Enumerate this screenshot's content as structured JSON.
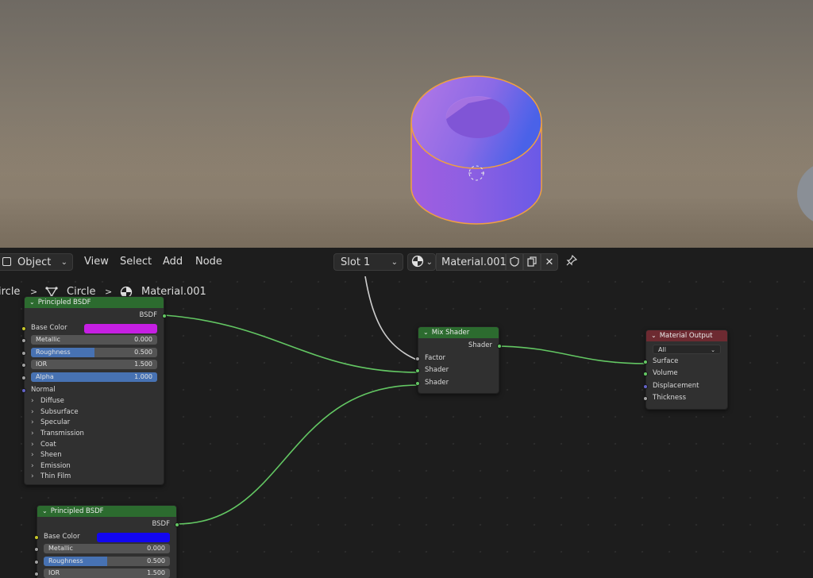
{
  "header": {
    "mode": "Object",
    "menus": [
      "View",
      "Select",
      "Add",
      "Node"
    ],
    "slot": "Slot 1",
    "material_name": "Material.001"
  },
  "breadcrumb": {
    "object": "ircle",
    "mesh": "Circle",
    "material": "Material.001"
  },
  "nodes": {
    "bsdf1": {
      "title": "Principled BSDF",
      "output": "BSDF",
      "base_color_label": "Base Color",
      "base_color": "#c61fe3",
      "metallic_label": "Metallic",
      "metallic": "0.000",
      "roughness_label": "Roughness",
      "roughness": "0.500",
      "ior_label": "IOR",
      "ior": "1.500",
      "alpha_label": "Alpha",
      "alpha": "1.000",
      "normal_label": "Normal",
      "panels": [
        "Diffuse",
        "Subsurface",
        "Specular",
        "Transmission",
        "Coat",
        "Sheen",
        "Emission",
        "Thin Film"
      ]
    },
    "bsdf2": {
      "title": "Principled BSDF",
      "output": "BSDF",
      "base_color_label": "Base Color",
      "base_color": "#1206f0",
      "metallic_label": "Metallic",
      "metallic": "0.000",
      "roughness_label": "Roughness",
      "roughness": "0.500",
      "ior_label": "IOR",
      "ior": "1.500"
    },
    "mix": {
      "title": "Mix Shader",
      "output": "Shader",
      "factor": "Factor",
      "shader_a": "Shader",
      "shader_b": "Shader"
    },
    "output": {
      "title": "Material Output",
      "target": "All",
      "surface": "Surface",
      "volume": "Volume",
      "displacement": "Displacement",
      "thickness": "Thickness"
    }
  },
  "colors": {
    "shader_socket": "#63c763",
    "color_socket": "#c7c729",
    "float_socket": "#a1a1a1",
    "vector_socket": "#6363c7",
    "shader_node_header": "#2c6b2f",
    "output_node_header": "#6d2a31",
    "slider_fill": "#4772b3",
    "object_color": "#9a5fe0",
    "selection_outline": "#f0a040"
  },
  "icons": {
    "editor_type": "node-editor-icon",
    "material_browse": "material-sphere-icon",
    "fake_user": "shield-icon",
    "duplicate": "duplicate-icon",
    "unlink": "close-icon",
    "pin": "pin-icon"
  }
}
